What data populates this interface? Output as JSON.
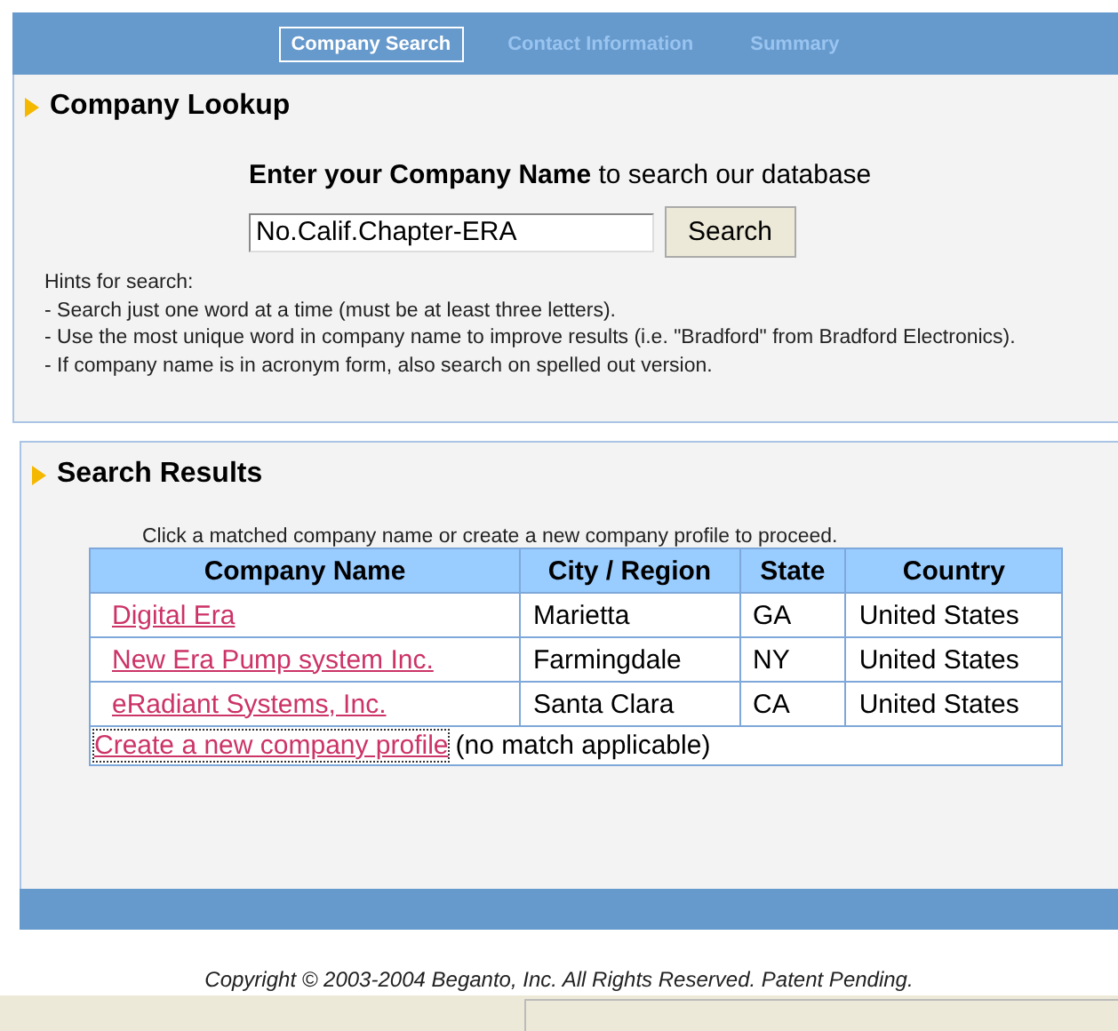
{
  "tabs": [
    {
      "label": "Company Search",
      "selected": true
    },
    {
      "label": "Contact Information",
      "selected": false
    },
    {
      "label": "Summary",
      "selected": false
    }
  ],
  "lookup": {
    "title": "Company Lookup",
    "prompt": "**Enter your Company Name** to search our database",
    "search_field": {
      "value": "No.Calif.Chapter-ERA"
    },
    "search_button": "Search",
    "hints": [
      "Hints for search:",
      "- Search just one word at a time (must be at least three letters).",
      "- Use the most unique word in company name to improve results (i.e. \"Bradford\" from Bradford Electronics).",
      "- If company name is in acronym form, also search on spelled out version."
    ]
  },
  "results": {
    "title": "Search Results",
    "instruction": "Click a matched company name or create a new company profile to proceed.",
    "columns": [
      "Company Name",
      "City / Region",
      "State",
      "Country"
    ],
    "rows": [
      {
        "company": "Digital Era",
        "city": "Marietta",
        "state": "GA",
        "country": "United States"
      },
      {
        "company": "New Era Pump system Inc.",
        "city": "Farmingdale",
        "state": "NY",
        "country": "United States"
      },
      {
        "company": "eRadiant Systems, Inc.",
        "city": "Santa Clara",
        "state": "CA",
        "country": "United States"
      }
    ],
    "create_link": "Create a new company profile",
    "create_note": "(no match applicable)"
  },
  "footer": "Copyright © 2003-2004 Beganto, Inc. All Rights Reserved. Patent Pending."
}
